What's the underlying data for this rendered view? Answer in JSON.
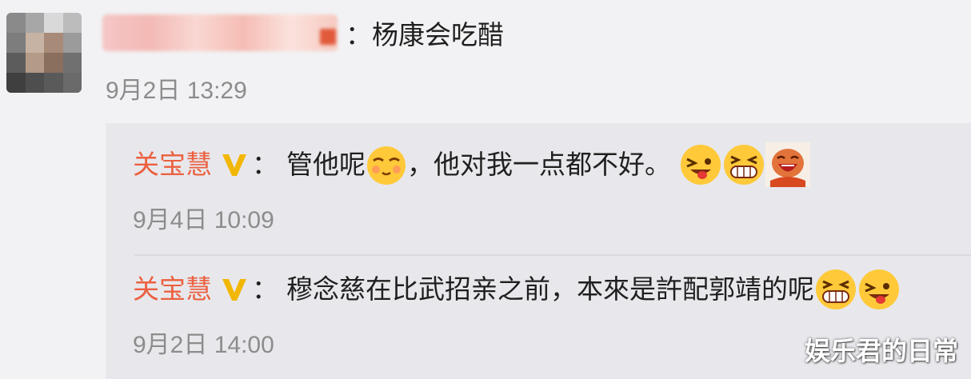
{
  "comment": {
    "text": "：杨康会吃醋",
    "time": "9月2日 13:29"
  },
  "replies": [
    {
      "name": "关宝慧",
      "badge": "V",
      "colon": "：",
      "text_before_emoji": "管他呢",
      "text_after_emoji": "，他对我一点都不好。",
      "emojis": [
        "shy-face-emoji",
        "tongue-wink-emoji",
        "grin-emoji",
        "laughing-face-emoji"
      ],
      "time": "9月4日 10:09"
    },
    {
      "name": "关宝慧",
      "badge": "V",
      "colon": "：",
      "text": "穆念慈在比武招亲之前，本來是許配郭靖的呢",
      "emojis": [
        "grin-emoji",
        "tongue-wink-emoji"
      ],
      "time": "9月2日 14:00"
    }
  ],
  "watermark": "娱乐君的日常",
  "colors": {
    "background": "#f2f2f4",
    "reply_panel": "#e8e8ec",
    "name": "#eb6040",
    "badge": "#f2b705",
    "text": "#1f1f1f",
    "time": "#8c8c8c"
  }
}
